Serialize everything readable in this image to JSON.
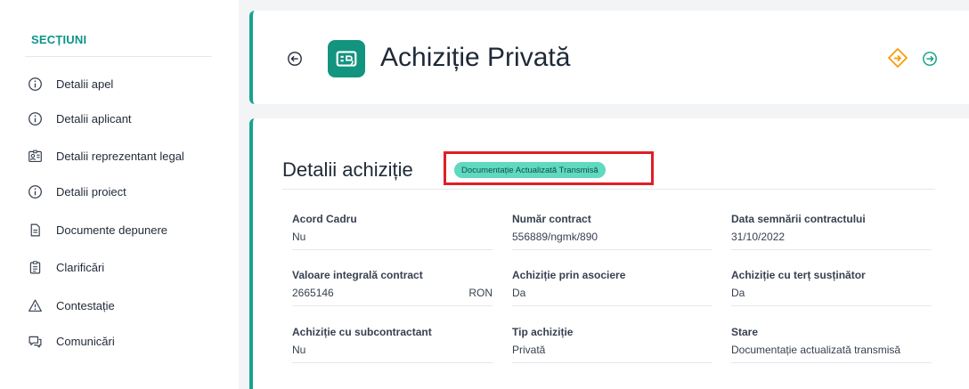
{
  "sidebar": {
    "title": "SECȚIUNI",
    "items": [
      {
        "label": "Detalii apel",
        "icon": "info-icon"
      },
      {
        "label": "Detalii aplicant",
        "icon": "info-icon"
      },
      {
        "label": "Detalii reprezentant legal",
        "icon": "id-card-icon"
      },
      {
        "label": "Detalii proiect",
        "icon": "info-icon"
      },
      {
        "label": "Documente depunere",
        "icon": "document-icon"
      },
      {
        "label": "Clarificări",
        "icon": "clipboard-icon"
      },
      {
        "label": "Contestație",
        "icon": "warning-icon"
      },
      {
        "label": "Comunicări",
        "icon": "chat-icon"
      }
    ]
  },
  "header": {
    "title": "Achiziție Privată",
    "badge_icon": "contract-icon"
  },
  "details": {
    "title": "Detalii achiziție",
    "status": "Documentație Actualizată Transmisă",
    "fields": [
      {
        "label": "Acord Cadru",
        "value": "Nu"
      },
      {
        "label": "Număr contract",
        "value": "556889/ngmk/890"
      },
      {
        "label": "Data semnării contractului",
        "value": "31/10/2022"
      },
      {
        "label": "Valoare integrală contract",
        "value": "2665146",
        "unit": "RON"
      },
      {
        "label": "Achiziție prin asociere",
        "value": "Da"
      },
      {
        "label": "Achiziție cu terț susținător",
        "value": "Da"
      },
      {
        "label": "Achiziție cu subcontractant",
        "value": "Nu"
      },
      {
        "label": "Tip achiziție",
        "value": "Privată"
      },
      {
        "label": "Stare",
        "value": "Documentație actualizată transmisă"
      }
    ]
  },
  "colors": {
    "accent": "#16a394",
    "status_pill": "#5fd9c0",
    "highlight": "#e11d26",
    "diamond": "#f59e0b"
  }
}
